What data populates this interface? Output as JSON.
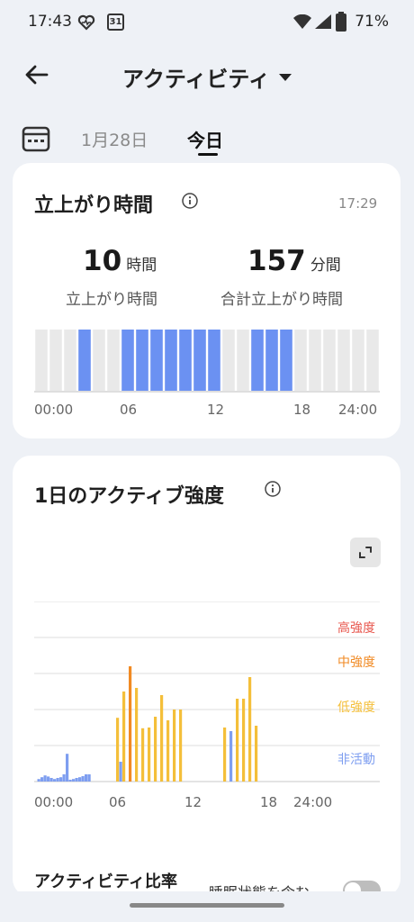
{
  "status_bar": {
    "time": "17:43",
    "calendar_date": "31",
    "battery": "71%"
  },
  "header": {
    "title": "アクティビティ"
  },
  "date_tabs": {
    "previous": "1月28日",
    "current": "今日"
  },
  "standing_card": {
    "title": "立上がり時間",
    "updated_time": "17:29",
    "hours_value": "10",
    "hours_unit": "時間",
    "hours_label": "立上がり時間",
    "minutes_value": "157",
    "minutes_unit": "分間",
    "minutes_label": "合計立上がり時間",
    "active_hours": [
      3,
      6,
      7,
      8,
      9,
      10,
      11,
      12,
      15,
      16,
      17
    ],
    "axis_labels": [
      "00:00",
      "06",
      "12",
      "18",
      "24:00"
    ],
    "colors": {
      "active": "#6b91f2",
      "inactive": "#e9e9e9"
    }
  },
  "intensity_card": {
    "title": "1日のアクティブ強度",
    "levels": [
      {
        "label": "高強度",
        "color": "#e8584f"
      },
      {
        "label": "中強度",
        "color": "#f18a23"
      },
      {
        "label": "低強度",
        "color": "#f4bf3a"
      },
      {
        "label": "非活動",
        "color": "#7e9ef0"
      }
    ],
    "axis_labels": [
      "00:00",
      "06",
      "12",
      "18",
      "24:00"
    ],
    "footer_label": "アクティビティ比率",
    "toggle_label": "睡眠状態を含む"
  },
  "chart_data": {
    "type": "bar",
    "title": "1日のアクティブ強度",
    "x_unit": "hour",
    "xlim": [
      0,
      24
    ],
    "x_ticks": [
      "00:00",
      "06",
      "12",
      "18",
      "24:00"
    ],
    "levels": [
      "非活動",
      "低強度",
      "中強度",
      "高強度"
    ],
    "bars": [
      {
        "x": 0.25,
        "value": 0.07,
        "level": "非活動"
      },
      {
        "x": 0.5,
        "value": 0.12,
        "level": "非活動"
      },
      {
        "x": 0.75,
        "value": 0.17,
        "level": "非活動"
      },
      {
        "x": 1.0,
        "value": 0.14,
        "level": "非活動"
      },
      {
        "x": 1.25,
        "value": 0.1,
        "level": "非活動"
      },
      {
        "x": 1.5,
        "value": 0.07,
        "level": "非活動"
      },
      {
        "x": 1.75,
        "value": 0.1,
        "level": "非活動"
      },
      {
        "x": 2.0,
        "value": 0.12,
        "level": "非活動"
      },
      {
        "x": 2.25,
        "value": 0.2,
        "level": "非活動"
      },
      {
        "x": 2.5,
        "value": 0.77,
        "level": "非活動"
      },
      {
        "x": 2.75,
        "value": 0.05,
        "level": "非活動"
      },
      {
        "x": 3.0,
        "value": 0.07,
        "level": "非活動"
      },
      {
        "x": 3.25,
        "value": 0.1,
        "level": "非活動"
      },
      {
        "x": 3.5,
        "value": 0.12,
        "level": "非活動"
      },
      {
        "x": 3.75,
        "value": 0.15,
        "level": "非活動"
      },
      {
        "x": 4.0,
        "value": 0.2,
        "level": "非活動"
      },
      {
        "x": 4.25,
        "value": 0.2,
        "level": "非活動"
      },
      {
        "x": 6.5,
        "value": 1.77,
        "level": "低強度"
      },
      {
        "x": 6.75,
        "value": 0.55,
        "level": "非活動"
      },
      {
        "x": 7.0,
        "value": 2.5,
        "level": "低強度"
      },
      {
        "x": 7.5,
        "value": 3.2,
        "level": "中強度"
      },
      {
        "x": 8.0,
        "value": 2.6,
        "level": "低強度"
      },
      {
        "x": 8.5,
        "value": 1.48,
        "level": "低強度"
      },
      {
        "x": 9.0,
        "value": 1.5,
        "level": "低強度"
      },
      {
        "x": 9.5,
        "value": 1.8,
        "level": "低強度"
      },
      {
        "x": 10.0,
        "value": 2.4,
        "level": "低強度"
      },
      {
        "x": 10.5,
        "value": 1.7,
        "level": "低強度"
      },
      {
        "x": 11.0,
        "value": 2.0,
        "level": "低強度"
      },
      {
        "x": 11.5,
        "value": 2.0,
        "level": "低強度"
      },
      {
        "x": 15.0,
        "value": 1.5,
        "level": "低強度"
      },
      {
        "x": 15.5,
        "value": 1.4,
        "level": "非活動"
      },
      {
        "x": 16.0,
        "value": 2.3,
        "level": "低強度"
      },
      {
        "x": 16.5,
        "value": 2.3,
        "level": "低強度"
      },
      {
        "x": 17.0,
        "value": 2.9,
        "level": "低強度"
      },
      {
        "x": 17.5,
        "value": 1.55,
        "level": "低強度"
      }
    ],
    "ylim": [
      0,
      5
    ],
    "grid": true
  }
}
